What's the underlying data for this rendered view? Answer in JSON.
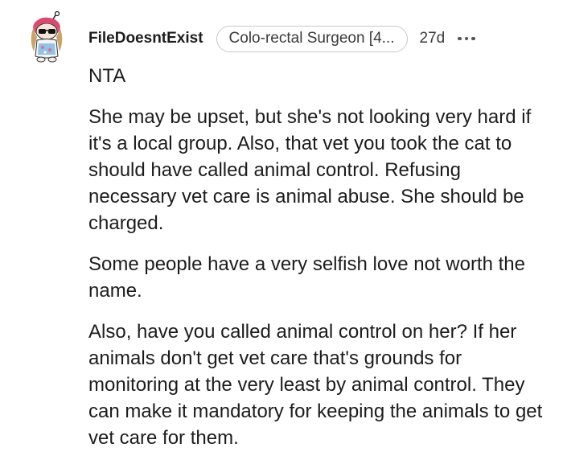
{
  "comment": {
    "username": "FileDoesntExist",
    "flair": "Colo-rectal Surgeon [4...",
    "age": "27d",
    "avatar_icon": "snoo-avatar-icon",
    "more_icon": "more-options-icon",
    "paragraphs": [
      "NTA",
      "She may be upset, but she's not looking very hard if it's a local group. Also, that vet you took the cat to should have called animal control. Refusing necessary vet care is animal abuse. She should be charged.",
      "Some people have a very selfish love not worth the name.",
      "Also, have you called animal control on her? If her animals don't get vet care that's grounds for monitoring at the very least by animal control. They can make it mandatory for keeping the animals to get vet care for them."
    ]
  }
}
